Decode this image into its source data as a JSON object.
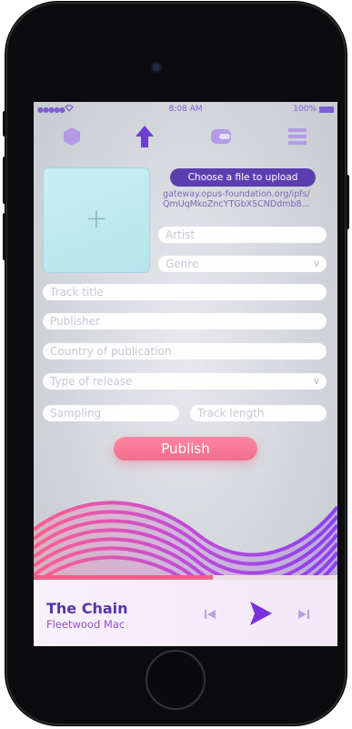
{
  "status": {
    "signal": "●●●●●",
    "time": "8:08 AM",
    "battery": "100%"
  },
  "nav": [
    {
      "icon": "hexagon-icon"
    },
    {
      "icon": "upload-arrow-icon",
      "active": true
    },
    {
      "icon": "wallet-icon"
    },
    {
      "icon": "hamburger-menu-icon"
    }
  ],
  "upload": {
    "choose_file_label": "Choose a file to upload",
    "ipfs_line1": "gateway.opus-foundation.org/ipfs/",
    "ipfs_line2": "QmUqMkoZncYTGbXSCNDdmb8..."
  },
  "form": {
    "artist_placeholder": "Artist",
    "genre_placeholder": "Genre",
    "track_title_placeholder": "Track title",
    "publisher_placeholder": "Publisher",
    "country_placeholder": "Country of publication",
    "release_type_placeholder": "Type of release",
    "sampling_placeholder": "Sampling",
    "track_length_placeholder": "Track length",
    "publish_label": "Publish"
  },
  "player": {
    "title": "The Chain",
    "artist": "Fleetwood Mac",
    "progress": 0.59
  },
  "colors": {
    "accent": "#7b5fd0",
    "accent_dark": "#5734a8",
    "publish": "#f06e8d",
    "progress": "#ef5f86"
  }
}
